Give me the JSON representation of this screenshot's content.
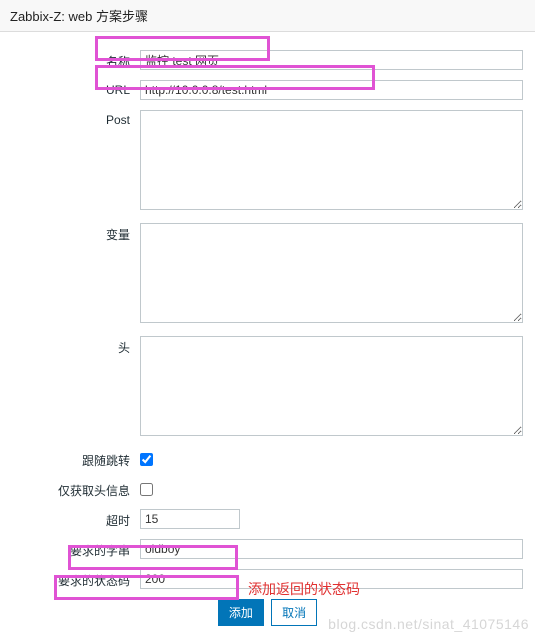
{
  "dialog": {
    "title": "Zabbix-Z: web 方案步骤"
  },
  "fields": {
    "name": {
      "label": "名称",
      "value": "监控 test 网页"
    },
    "url": {
      "label": "URL",
      "value": "http://10.0.0.8/test.html"
    },
    "post": {
      "label": "Post",
      "value": ""
    },
    "variables": {
      "label": "变量",
      "value": ""
    },
    "headers": {
      "label": "头",
      "value": ""
    },
    "followRedirect": {
      "label": "跟随跳转"
    },
    "headOnly": {
      "label": "仅获取头信息"
    },
    "timeout": {
      "label": "超时",
      "value": "15"
    },
    "requiredString": {
      "label": "要求的字串",
      "value": "oldboy"
    },
    "requiredStatus": {
      "label": "要求的状态码",
      "value": "200"
    }
  },
  "buttons": {
    "add": "添加",
    "cancel": "取消"
  },
  "annotation": "添加返回的状态码",
  "watermark": "blog.csdn.net/sinat_41075146"
}
